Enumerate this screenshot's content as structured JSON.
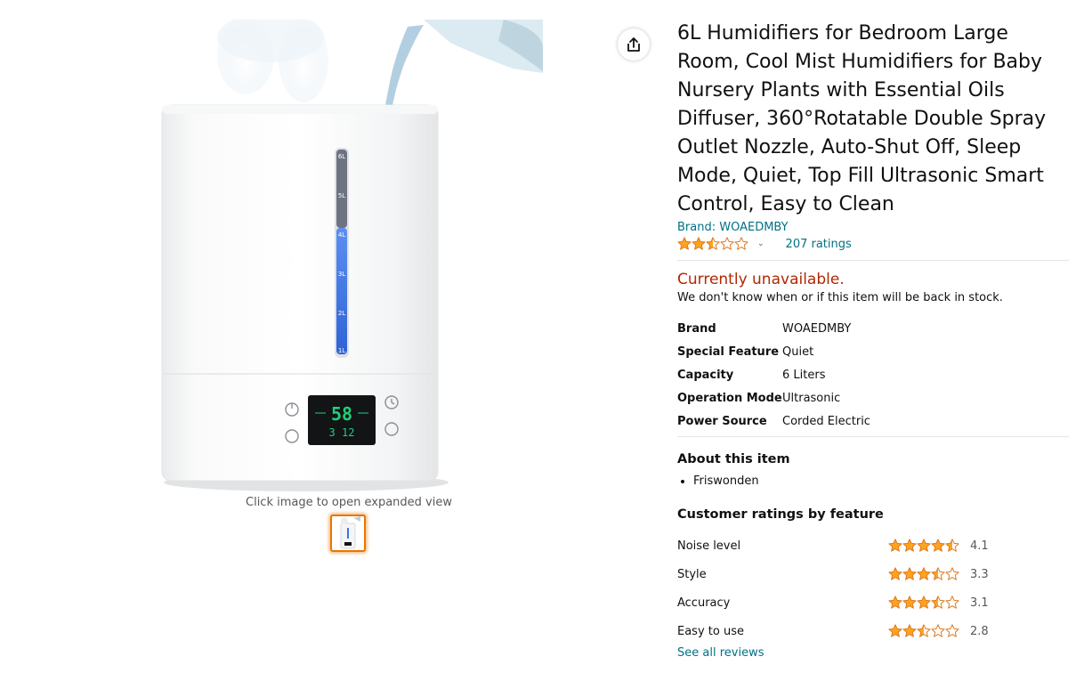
{
  "product": {
    "title": "6L Humidifiers for Bedroom Large Room, Cool Mist Humidifiers for Baby Nursery Plants with Essential Oils Diffuser, 360°Rotatable Double Spray Outlet Nozzle, Auto-Shut Off, Sleep Mode, Quiet, Top Fill Ultrasonic Smart Control, Easy to Clean",
    "brand_link": "Brand: WOAEDMBY",
    "rating": 2.5,
    "ratings_count": "207 ratings"
  },
  "availability": {
    "status": "Currently unavailable.",
    "note": "We don't know when or if this item will be back in stock."
  },
  "specs": [
    {
      "key": "Brand",
      "value": "WOAEDMBY"
    },
    {
      "key": "Special Feature",
      "value": "Quiet"
    },
    {
      "key": "Capacity",
      "value": "6 Liters"
    },
    {
      "key": "Operation Mode",
      "value": "Ultrasonic"
    },
    {
      "key": "Power Source",
      "value": "Corded Electric"
    }
  ],
  "about": {
    "heading": "About this item",
    "items": [
      "Friswonden"
    ]
  },
  "feature_ratings": {
    "heading": "Customer ratings by feature",
    "items": [
      {
        "label": "Noise level",
        "value": "4.1",
        "stars": 4.5
      },
      {
        "label": "Style",
        "value": "3.3",
        "stars": 3.5
      },
      {
        "label": "Accuracy",
        "value": "3.1",
        "stars": 3.5
      },
      {
        "label": "Easy to use",
        "value": "2.8",
        "stars": 2.5
      }
    ],
    "see_all": "See all reviews"
  },
  "image": {
    "caption": "Click image to open expanded view",
    "display_level": "58",
    "display_time": "3 12",
    "tank_marks": [
      "6L",
      "5L",
      "4L",
      "3L",
      "2L",
      "1L"
    ]
  },
  "colors": {
    "star": "#ffa41c",
    "link": "#007185",
    "unavailable": "#b12704",
    "thumb_border": "#e77600",
    "display_digits": "#1fd07a",
    "water_level": "#3b73e8"
  },
  "icons": {
    "share": "share-icon",
    "chevron": "chevron-down-icon",
    "star": "star-icon"
  }
}
